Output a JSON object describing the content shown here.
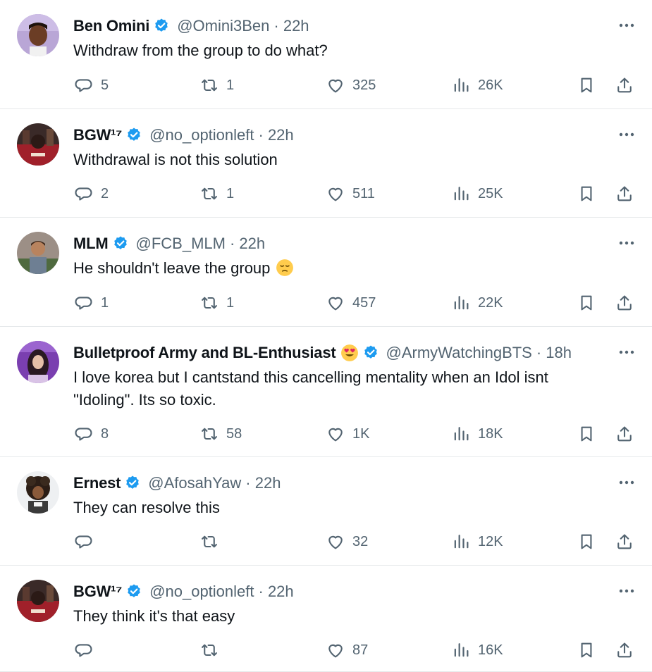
{
  "colors": {
    "text": "#0f1419",
    "muted": "#536471",
    "verified": "#1d9bf0",
    "divider": "#e6e9eb"
  },
  "icons": {
    "reply": "speech-bubble-icon",
    "retweet": "retweet-arrows-icon",
    "like": "heart-icon",
    "views": "bar-chart-icon",
    "bookmark": "bookmark-icon",
    "share": "share-upload-icon",
    "more": "ellipsis-icon",
    "verified": "verified-badge-icon"
  },
  "tweets": [
    {
      "name": "Ben Omini",
      "handle": "@Omini3Ben",
      "time": "· 22h",
      "text": "Withdraw from the group to do what?",
      "emoji_after_text": "",
      "replies": "5",
      "retweets": "1",
      "likes": "325",
      "views": "26K"
    },
    {
      "name": "BGW¹⁷",
      "handle": "@no_optionleft",
      "time": "· 22h",
      "text": "Withdrawal is not this solution",
      "emoji_after_text": "",
      "replies": "2",
      "retweets": "1",
      "likes": "511",
      "views": "25K"
    },
    {
      "name": "MLM",
      "handle": "@FCB_MLM",
      "time": "· 22h",
      "text": "He shouldn't leave the group",
      "emoji_after_text": "pensive-face",
      "replies": "1",
      "retweets": "1",
      "likes": "457",
      "views": "22K"
    },
    {
      "name": "Bulletproof Army and BL-Enthusiast",
      "name_emoji": "heart-eyes-face",
      "handle": "@ArmyWatchingBTS",
      "time": "· 18h",
      "text": "I love korea but I cantstand this cancelling mentality when an Idol isnt \"Idoling\". Its so toxic.",
      "emoji_after_text": "",
      "replies": "8",
      "retweets": "58",
      "likes": "1K",
      "views": "18K"
    },
    {
      "name": "Ernest",
      "handle": "@AfosahYaw",
      "time": "· 22h",
      "text": "They can resolve this",
      "emoji_after_text": "",
      "replies": "",
      "retweets": "",
      "likes": "32",
      "views": "12K"
    },
    {
      "name": "BGW¹⁷",
      "handle": "@no_optionleft",
      "time": "· 22h",
      "text": "They think it's that easy",
      "emoji_after_text": "",
      "replies": "",
      "retweets": "",
      "likes": "87",
      "views": "16K"
    }
  ]
}
